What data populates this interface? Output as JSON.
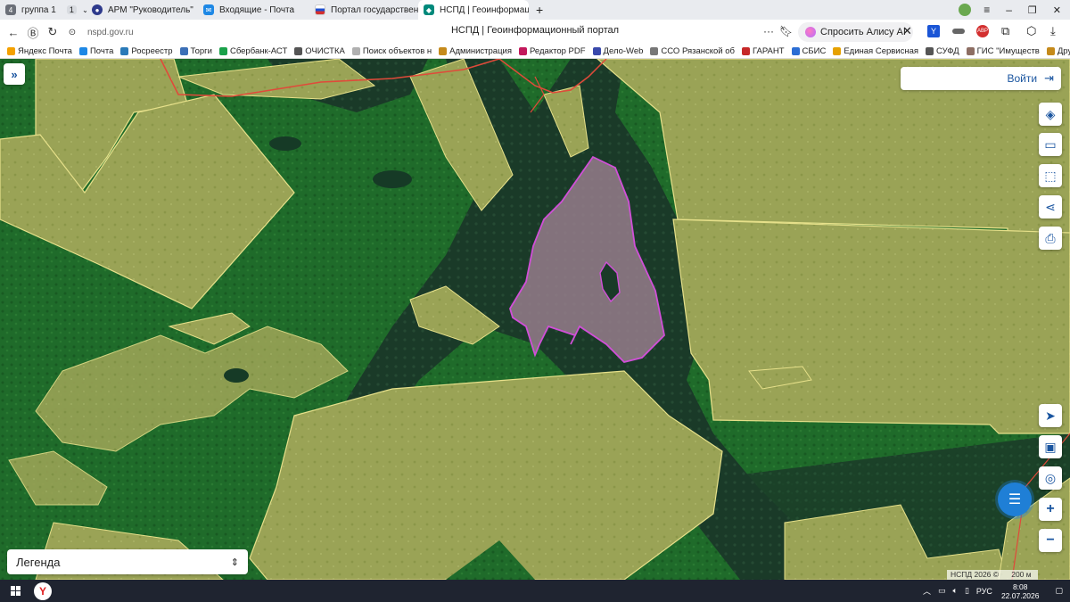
{
  "browser": {
    "tabs": [
      {
        "label": "группа 1",
        "count": "4",
        "num": "1",
        "icon": "tab-group-icon",
        "color": "#6b6f78"
      },
      {
        "label": "АРМ \"Руководитель\"",
        "icon": "arm-icon",
        "color": "#2e3a8c"
      },
      {
        "label": "Входящие - Почта",
        "icon": "mail-icon",
        "color": "#1e88e5"
      },
      {
        "label": "Портал государственных",
        "icon": "gosuslugi-icon",
        "color": "#d32f2f"
      },
      {
        "label": "НСПД | Геоинформац",
        "icon": "nspd-icon",
        "color": "#00897b",
        "active": true
      }
    ],
    "url": "nspd.gov.ru",
    "page_title": "НСПД | Геоинформационный портал",
    "alice_label": "Спросить Алису AI",
    "bookmarks": [
      {
        "label": "Яндекс Почта",
        "color": "#f4a100"
      },
      {
        "label": "Почта",
        "color": "#1e88e5"
      },
      {
        "label": "Росреестр",
        "color": "#2a7ab8"
      },
      {
        "label": "Торги",
        "color": "#3b6fb6"
      },
      {
        "label": "Сбербанк-АСТ",
        "color": "#1aa14a"
      },
      {
        "label": "ОЧИСТКА",
        "color": "#555555"
      },
      {
        "label": "Поиск объектов н",
        "color": "#b0b0b0"
      },
      {
        "label": "Администрация",
        "color": "#c58a1b"
      },
      {
        "label": "Редактор PDF",
        "color": "#c2185b"
      },
      {
        "label": "Дело-Web",
        "color": "#3949ab"
      },
      {
        "label": "ССО Рязанской об",
        "color": "#777777"
      },
      {
        "label": "ГАРАНТ",
        "color": "#c62828"
      },
      {
        "label": "СБИС",
        "color": "#2b6ed4"
      },
      {
        "label": "Единая Сервисная",
        "color": "#e6a100"
      },
      {
        "label": "СУФД",
        "color": "#555555"
      },
      {
        "label": "ГИС \"Имуществ",
        "color": "#8d6e63"
      },
      {
        "label": "",
        "color": "#c58a1b"
      }
    ],
    "other_bookmarks": "Другие закладки"
  },
  "map": {
    "login_label": "Войти",
    "legend_label": "Легенда",
    "attribution": "НСПД 2026 ©",
    "scale_label": "200 м",
    "right_controls": [
      "layers-icon",
      "ruler-icon",
      "select-area-icon",
      "share-icon",
      "print-icon"
    ],
    "bottom_controls": [
      "locate-icon",
      "basemap-icon",
      "my-location-icon"
    ],
    "zoom_in": "+",
    "zoom_out": "−"
  },
  "taskbar": {
    "language": "РУС",
    "time": "8:08",
    "date": "22.07.2026"
  }
}
